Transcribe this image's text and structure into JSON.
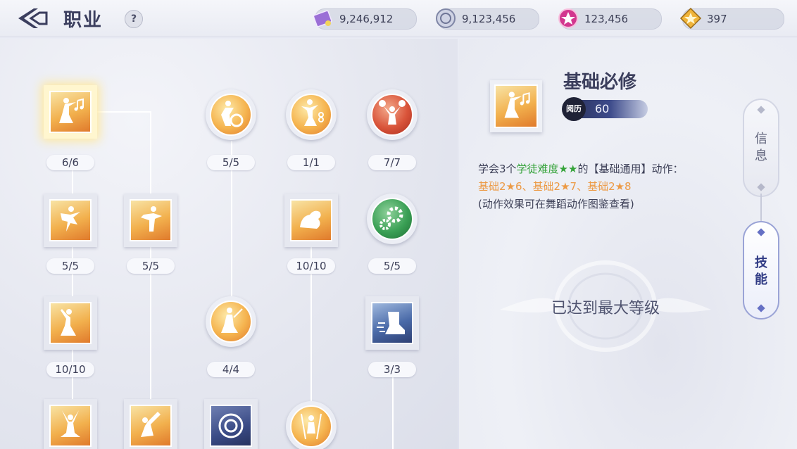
{
  "header": {
    "title": "职业",
    "help_label": "?"
  },
  "resources": [
    {
      "icon": "purple-ticket-icon",
      "value": "9,246,912"
    },
    {
      "icon": "silver-coin-icon",
      "value": "9,123,456"
    },
    {
      "icon": "pink-gem-icon",
      "value": "123,456"
    },
    {
      "icon": "gold-star-coin-icon",
      "value": "397"
    }
  ],
  "skill_tree": {
    "nodes": [
      {
        "id": "basic-required",
        "shape": "square",
        "icon": "dancer-music-icon",
        "level": "6/6",
        "selected": true
      },
      {
        "id": "dance-1",
        "shape": "square",
        "icon": "ballet-dancer-icon",
        "level": "5/5"
      },
      {
        "id": "dance-2",
        "shape": "square",
        "icon": "ballet-leap-icon",
        "level": "5/5"
      },
      {
        "id": "dance-3",
        "shape": "square",
        "icon": "dancer-pose-icon",
        "level": "10/10"
      },
      {
        "id": "dance-4",
        "shape": "square",
        "icon": "dancer-arms-up-icon",
        "level": ""
      },
      {
        "id": "dance-5",
        "shape": "square",
        "icon": "dancer-arch-icon",
        "level": ""
      },
      {
        "id": "drum-performer",
        "shape": "circle",
        "icon": "drummer-icon",
        "level": "5/5"
      },
      {
        "id": "conductor",
        "shape": "circle",
        "icon": "conductor-baton-icon",
        "level": "4/4"
      },
      {
        "id": "emblem-skill",
        "shape": "square",
        "icon": "medal-emblem-icon",
        "level": ""
      },
      {
        "id": "music-dancer",
        "shape": "circle",
        "icon": "dancer-note-icon",
        "level": "1/1"
      },
      {
        "id": "strength",
        "shape": "square",
        "icon": "flexed-arm-icon",
        "level": "10/10"
      },
      {
        "id": "pole-dancer",
        "shape": "circle",
        "icon": "pole-dancer-icon",
        "level": ""
      },
      {
        "id": "cheerleader",
        "shape": "circle",
        "icon": "cheerleader-icon",
        "level": "7/7"
      },
      {
        "id": "gears",
        "shape": "circle",
        "icon": "gears-icon",
        "level": "5/5"
      },
      {
        "id": "speed-boot",
        "shape": "square",
        "icon": "speed-boot-icon",
        "level": "3/3"
      }
    ]
  },
  "detail": {
    "skill_name": "基础必修",
    "exp_badge": "阅历",
    "exp_value": "60",
    "desc_prefix": "学会3个",
    "desc_green": "学徒难度★★",
    "desc_suffix": "的【基础通用】动作：",
    "desc_actions": "基础2★6、基础2★7、基础2★8",
    "desc_note": "(动作效果可在舞蹈动作图鉴查看)",
    "max_level": "已达到最大等级"
  },
  "side_tabs": [
    {
      "label": "信\n息",
      "active": false
    },
    {
      "label": "技\n能",
      "active": true
    }
  ],
  "colors": {
    "accent_green": "#35a33a",
    "accent_orange": "#ec9a45",
    "tile_gold": "#f2b04d",
    "active_tab": "#2f3a84"
  }
}
